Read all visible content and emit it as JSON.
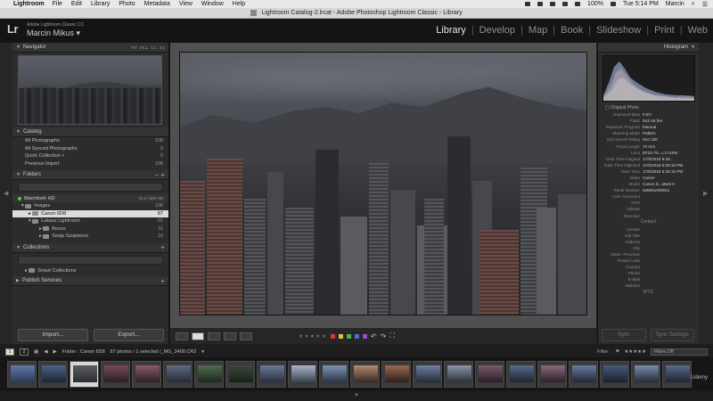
{
  "menubar": {
    "app_name": "Lightroom",
    "items": [
      "File",
      "Edit",
      "Library",
      "Photo",
      "Metadata",
      "View",
      "Window",
      "Help"
    ],
    "battery": "100%",
    "clock": "Tue 5:14 PM",
    "user": "Marcin"
  },
  "titlebar": {
    "title": "Lightroom Catalog-2.lrcat - Adobe Photoshop Lightroom Classic - Library"
  },
  "identity": {
    "logo": "Lr",
    "product": "Adobe Lightroom Classic CC",
    "user": "Marcin Mikus"
  },
  "modules": [
    "Library",
    "Develop",
    "Map",
    "Book",
    "Slideshow",
    "Print",
    "Web"
  ],
  "left_panel": {
    "navigator": {
      "title": "Navigator",
      "options": [
        "FIT",
        "FILL",
        "1:1",
        "3:1"
      ]
    },
    "catalog": {
      "title": "Catalog",
      "items": [
        {
          "label": "All Photographs",
          "count": "108"
        },
        {
          "label": "All Synced Photographs",
          "count": "0"
        },
        {
          "label": "Quick Collection +",
          "count": "0"
        },
        {
          "label": "Previous Import",
          "count": "108"
        }
      ]
    },
    "folders": {
      "title": "Folders",
      "volume": {
        "name": "Macintosh HD",
        "size": "42.4 / 500 GB"
      },
      "items": [
        {
          "label": "Images",
          "count": "108"
        },
        {
          "label": "Canon 6D8",
          "count": "87"
        },
        {
          "label": "Lukasz Lightroom",
          "count": "21"
        },
        {
          "label": "Bosco",
          "count": "11"
        },
        {
          "label": "Sesja Szopience",
          "count": "10"
        }
      ]
    },
    "collections": {
      "title": "Collections",
      "items": [
        {
          "label": "Smart Collections"
        }
      ]
    },
    "publish": {
      "title": "Publish Services"
    },
    "import_label": "Import...",
    "export_label": "Export..."
  },
  "right_panel": {
    "histogram": {
      "title": "Histogram",
      "iso": "ISO 100",
      "focal": "70 mm",
      "aperture": "f / 4.0",
      "shutter": "1/5 sec"
    },
    "original_photo": "Original Photo",
    "metadata": [
      {
        "key": "Exposure Bias",
        "value": "0 EV"
      },
      {
        "key": "Flash",
        "value": "Did not fire"
      },
      {
        "key": "Exposure Program",
        "value": "Manual"
      },
      {
        "key": "Metering Mode",
        "value": "Pattern"
      },
      {
        "key": "ISO Speed Rating",
        "value": "ISO 100"
      },
      {
        "key": "Focal Length",
        "value": "70 mm"
      },
      {
        "key": "Lens",
        "value": "EF24-70...L II USM"
      },
      {
        "key": "Date Time Original",
        "value": "17/5/2018 6:28..."
      },
      {
        "key": "Date Time Digitized",
        "value": "17/5/2018 6:28:15 PM"
      },
      {
        "key": "Date Time",
        "value": "17/5/2018 6:28:15 PM"
      },
      {
        "key": "Make",
        "value": "Canon"
      },
      {
        "key": "Model",
        "value": "Canon E...Mark II"
      },
      {
        "key": "Serial Number",
        "value": "038051000911"
      },
      {
        "key": "User Comment",
        "value": ""
      },
      {
        "key": "GPS",
        "value": ""
      },
      {
        "key": "Altitude",
        "value": ""
      },
      {
        "key": "Direction",
        "value": ""
      }
    ],
    "contact_header": "Contact",
    "contact": [
      {
        "key": "Creator",
        "value": ""
      },
      {
        "key": "Job Title",
        "value": ""
      },
      {
        "key": "Address",
        "value": ""
      },
      {
        "key": "City",
        "value": ""
      },
      {
        "key": "State / Province",
        "value": ""
      },
      {
        "key": "Postal Code",
        "value": ""
      },
      {
        "key": "Country",
        "value": ""
      },
      {
        "key": "Phone",
        "value": ""
      },
      {
        "key": "E-Mail",
        "value": ""
      },
      {
        "key": "Website",
        "value": ""
      }
    ],
    "iptc_header": "IPTC",
    "sync_label": "Sync",
    "sync_settings_label": "Sync Settings"
  },
  "toolbar": {
    "stars": "★★★★★"
  },
  "filmstrip": {
    "page1": "1",
    "page2": "2",
    "folder": "Folder : Canon 6D8",
    "info": "87 photos / 1 selected /_MG_3468.CR2",
    "filter_label": "Filter :",
    "filter_value": "Filters Off",
    "watermark": "Udemy"
  },
  "colors": {
    "menubar": "#e9e9e9",
    "panel": "#2c2c2c",
    "selected_row": "#dcdcdc",
    "active_module": "#e8e8e8"
  }
}
